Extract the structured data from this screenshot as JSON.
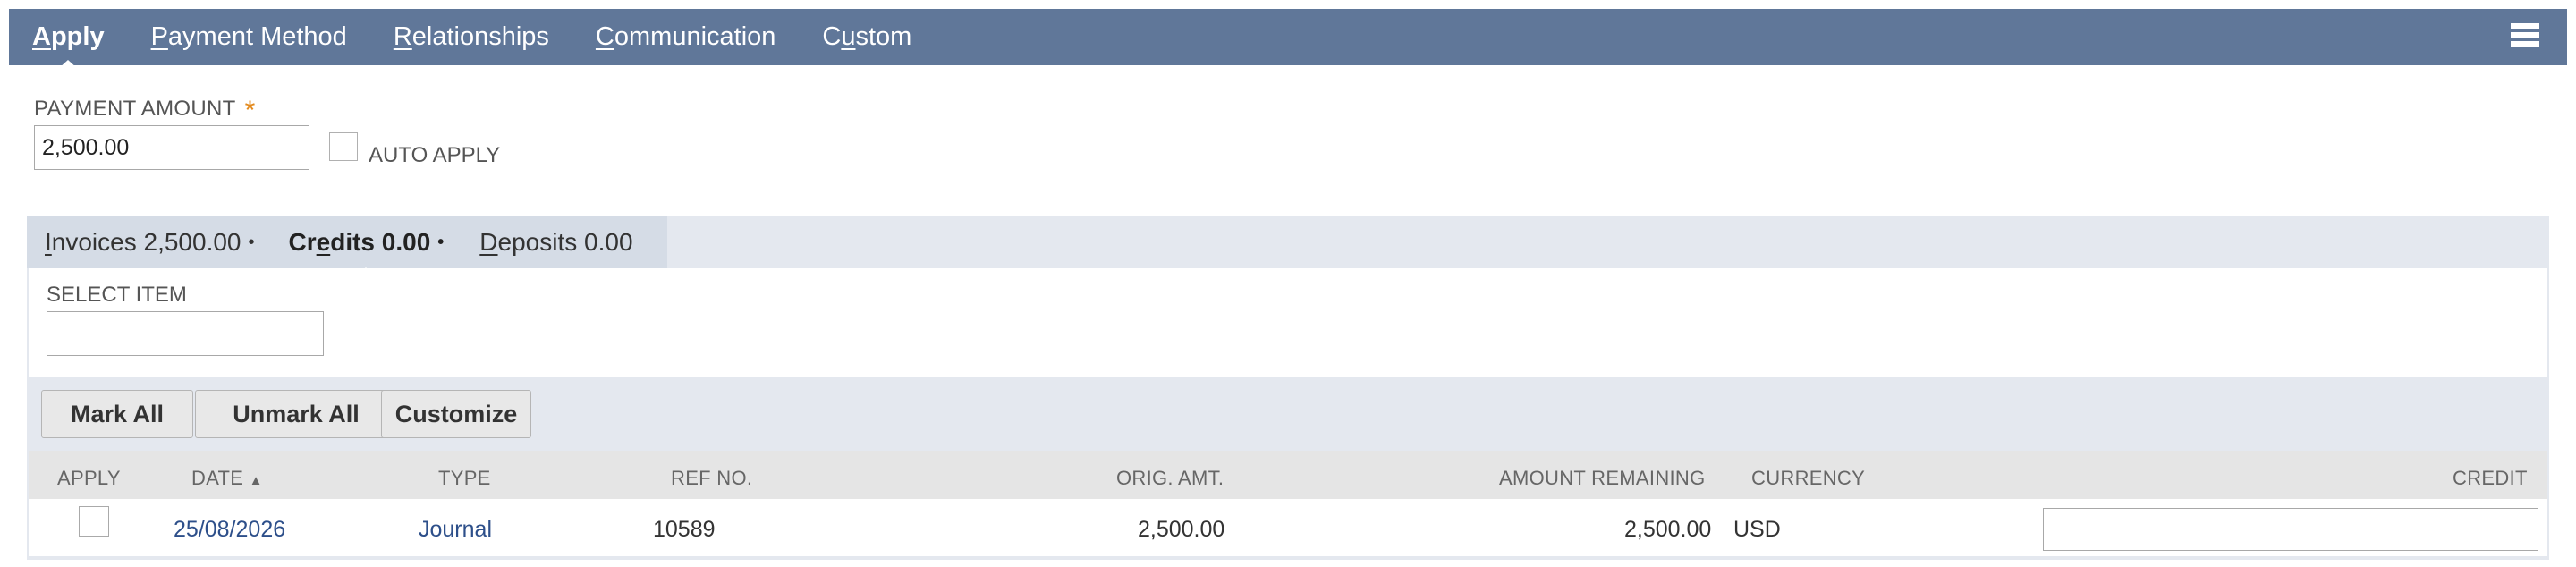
{
  "tabs": [
    {
      "pre": "",
      "u": "A",
      "post": "pply",
      "active": true
    },
    {
      "pre": "",
      "u": "P",
      "post": "ayment Method",
      "active": false
    },
    {
      "pre": "",
      "u": "R",
      "post": "elationships",
      "active": false
    },
    {
      "pre": "",
      "u": "C",
      "post": "ommunication",
      "active": false
    },
    {
      "pre": "C",
      "u": "u",
      "post": "stom",
      "active": false
    }
  ],
  "payment": {
    "label": "PAYMENT AMOUNT",
    "required_mark": "*",
    "value": "2,500.00",
    "auto_apply_label": "AUTO APPLY",
    "auto_apply_checked": false
  },
  "subtabs": [
    {
      "pre": "",
      "u": "I",
      "post": "nvoices 2,500.00",
      "dot": "•",
      "active": false
    },
    {
      "pre": "Cr",
      "u": "e",
      "post": "dits 0.00",
      "dot": "•",
      "active": true
    },
    {
      "pre": "",
      "u": "D",
      "post": "eposits 0.00",
      "dot": "",
      "active": false
    }
  ],
  "select_item": {
    "label": "SELECT ITEM",
    "value": ""
  },
  "buttons": {
    "mark_all": "Mark All",
    "unmark_all": "Unmark All",
    "customize": "Customize"
  },
  "columns": {
    "apply": "APPLY",
    "date": "DATE",
    "date_sort": "▲",
    "type": "TYPE",
    "ref_no": "REF NO.",
    "orig_amt": "ORIG. AMT.",
    "amount_remaining": "AMOUNT REMAINING",
    "currency": "CURRENCY",
    "credit": "CREDIT"
  },
  "rows": [
    {
      "apply": false,
      "date": "25/08/2026",
      "type": "Journal",
      "ref_no": "10589",
      "orig_amt": "2,500.00",
      "amount_remaining": "2,500.00",
      "currency": "USD",
      "credit": ""
    }
  ],
  "colors": {
    "tab_bar": "#607799",
    "link": "#2d4f8a",
    "required": "#e38a1e"
  }
}
